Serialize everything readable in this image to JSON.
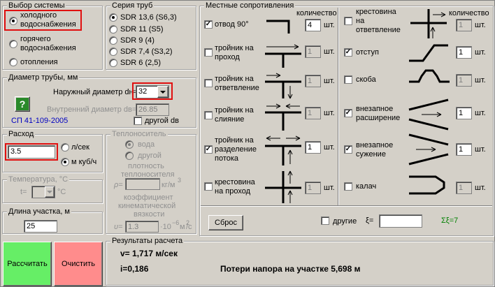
{
  "system": {
    "title": "Выбор системы",
    "opt1": "холодного водоснабжения",
    "opt1a": "холодного",
    "opt1b": "водоснабжения",
    "opt2a": "горячего",
    "opt2b": "водоснабжения",
    "opt3": "отопления"
  },
  "series": {
    "title": "Серия труб",
    "items": [
      "SDR 13,6 (S6,3)",
      "SDR 11 (S5)",
      "SDR 9 (4)",
      "SDR 7,4 (S3,2)",
      "SDR 6 (2,5)"
    ]
  },
  "diameter": {
    "title": "Диаметр трубы, мм",
    "outer_label": "Наружный диаметр dн=",
    "outer_value": "32",
    "inner_label": "Внутренний диаметр dв=",
    "inner_value": "26.85",
    "other_label": "другой dв",
    "link": "СП 41-109-2005"
  },
  "flow": {
    "title": "Расход",
    "value": "3.5",
    "unit1": "л/сек",
    "unit2": "м куб/ч"
  },
  "temperature": {
    "title": "Температура, °С",
    "t_label": "t=",
    "unit": "°С"
  },
  "length": {
    "title": "Длина участка, м",
    "value": "25"
  },
  "coolant": {
    "title": "Теплоноситель",
    "opt1": "вода",
    "opt2": "другой",
    "density_a": "плотность",
    "density_b": "теплоносителя",
    "rho": "ρ=",
    "rho_unit": "кг/м",
    "coef_a": "коэффициент",
    "coef_b": "кинематической",
    "coef_c": "вязкости",
    "nu": "υ=",
    "nu_value": "1.3",
    "nu_unit": "·10",
    "nu_exp": "−6",
    "nu_unit2": "м",
    "nu_unit3": "/с"
  },
  "local": {
    "title": "Местные сопротивления",
    "qty_header": "количество",
    "qty_header2": "количество",
    "unit": "шт.",
    "left": [
      {
        "a": "отвод 90°",
        "b": "",
        "c": "",
        "checked": true,
        "qty": "4"
      },
      {
        "a": "тройник на",
        "b": "проход",
        "c": "",
        "checked": false,
        "qty": "1"
      },
      {
        "a": "тройник на",
        "b": "ответвление",
        "c": "",
        "checked": false,
        "qty": "1"
      },
      {
        "a": "тройник на",
        "b": "слияние",
        "c": "",
        "checked": false,
        "qty": "1"
      },
      {
        "a": "тройник на",
        "b": "разделение",
        "c": "потока",
        "checked": true,
        "qty": "1"
      },
      {
        "a": "крестовина",
        "b": "на проход",
        "c": "",
        "checked": false,
        "qty": "1"
      }
    ],
    "right": [
      {
        "a": "крестовина",
        "b": "на",
        "c": "ответвление",
        "checked": false,
        "qty": "1"
      },
      {
        "a": "отступ",
        "b": "",
        "c": "",
        "checked": true,
        "qty": "1"
      },
      {
        "a": "скоба",
        "b": "",
        "c": "",
        "checked": false,
        "qty": "1"
      },
      {
        "a": "внезапное",
        "b": "расширение",
        "c": "",
        "checked": true,
        "qty": "1"
      },
      {
        "a": "внезапное",
        "b": "сужение",
        "c": "",
        "checked": true,
        "qty": "1"
      },
      {
        "a": "калач",
        "b": "",
        "c": "",
        "checked": false,
        "qty": "1"
      }
    ],
    "reset": "Сброс",
    "other": "другие",
    "xi": "ξ=",
    "sum": "Σξ=7"
  },
  "results": {
    "title": "Результаты расчета",
    "velocity": "v= 1,717 м/сек",
    "i": "i=0,186",
    "loss": "Потери напора на участке 5,698 м"
  },
  "buttons": {
    "calc": "Рассчитать",
    "clear": "Очистить"
  },
  "colors": {
    "calc_bg": "#66ee66",
    "clear_bg": "#ff8c8c",
    "highlight": "#e01010",
    "link": "#0000c0",
    "sum": "#008000"
  }
}
